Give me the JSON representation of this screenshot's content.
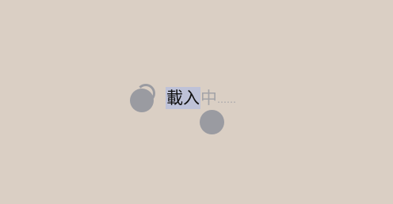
{
  "loading": {
    "highlighted_text": "載入",
    "rest_text": "中",
    "ellipsis": "……"
  },
  "colors": {
    "background": "#dacfc4",
    "spinner": "#9a9ba1",
    "highlight": "#bec2d8",
    "dim_text": "#a3a3a7"
  }
}
